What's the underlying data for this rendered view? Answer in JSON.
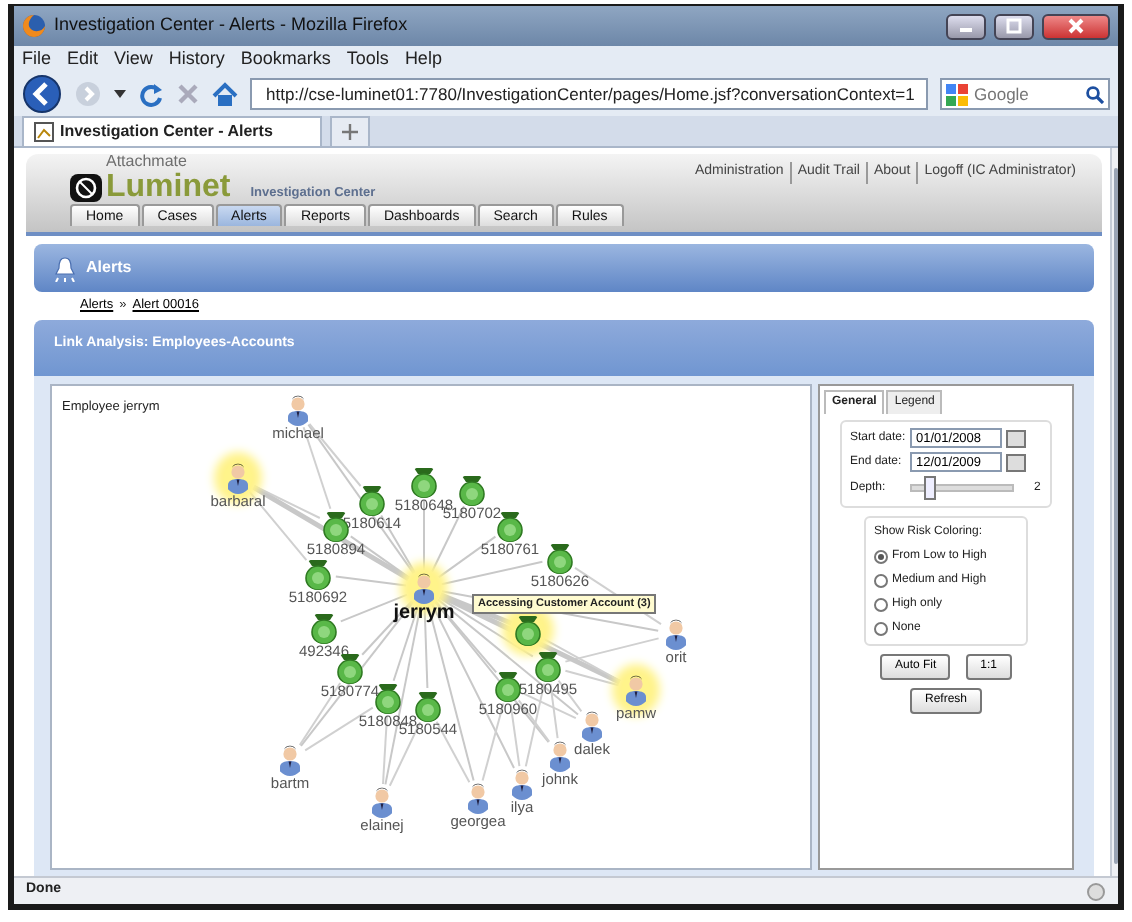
{
  "window": {
    "title": "Investigation Center - Alerts - Mozilla Firefox"
  },
  "menu": [
    "File",
    "Edit",
    "View",
    "History",
    "Bookmarks",
    "Tools",
    "Help"
  ],
  "toolbar": {
    "url": "http://cse-luminet01:7780/InvestigationCenter/pages/Home.jsf?conversationContext=1",
    "search_placeholder": "Google"
  },
  "browser_tabs": [
    {
      "label": "Investigation Center - Alerts",
      "selected": true
    }
  ],
  "app": {
    "brand": {
      "company": "Attachmate",
      "product": "Luminet",
      "module": "Investigation Center"
    },
    "top_links": [
      "Administration",
      "Audit Trail",
      "About",
      "Logoff (IC Administrator)"
    ],
    "tabs": [
      {
        "label": "Home",
        "selected": false
      },
      {
        "label": "Cases",
        "selected": false
      },
      {
        "label": "Alerts",
        "selected": true
      },
      {
        "label": "Reports",
        "selected": false
      },
      {
        "label": "Dashboards",
        "selected": false
      },
      {
        "label": "Search",
        "selected": false
      },
      {
        "label": "Rules",
        "selected": false
      }
    ],
    "section_title": "Alerts",
    "breadcrumb": [
      "Alerts",
      "Alert 00016"
    ],
    "breadcrumb_separator": "»",
    "panel_title": "Link Analysis: Employees-Accounts"
  },
  "graph": {
    "caption": "Employee jerrym",
    "tooltip": "Accessing Customer Account (3)",
    "nodes": [
      {
        "kind": "person",
        "label": "michael",
        "highlighted": false,
        "central": false
      },
      {
        "kind": "person",
        "label": "barbaral",
        "highlighted": true,
        "central": false
      },
      {
        "kind": "account",
        "label": "5180648",
        "highlighted": false,
        "central": false
      },
      {
        "kind": "account",
        "label": "5180702",
        "highlighted": false,
        "central": false
      },
      {
        "kind": "account",
        "label": "5180614",
        "highlighted": false,
        "central": false
      },
      {
        "kind": "account",
        "label": "5180894",
        "highlighted": false,
        "central": false
      },
      {
        "kind": "account",
        "label": "5180761",
        "highlighted": false,
        "central": false
      },
      {
        "kind": "account",
        "label": "5180626",
        "highlighted": false,
        "central": false
      },
      {
        "kind": "account",
        "label": "5180692",
        "highlighted": false,
        "central": false
      },
      {
        "kind": "person",
        "label": "jerrym",
        "highlighted": true,
        "central": true
      },
      {
        "kind": "person",
        "label": "orit",
        "highlighted": false,
        "central": false
      },
      {
        "kind": "account",
        "label": "492346",
        "highlighted": false,
        "central": false
      },
      {
        "kind": "account",
        "highlighted": true
      },
      {
        "kind": "account",
        "label": "5180495",
        "highlighted": false,
        "central": false
      },
      {
        "kind": "account",
        "label": "5180774",
        "highlighted": false,
        "central": false
      },
      {
        "kind": "account",
        "label": "5180960",
        "highlighted": false,
        "central": false
      },
      {
        "kind": "person",
        "label": "pamw",
        "highlighted": true,
        "central": false
      },
      {
        "kind": "account",
        "label": "5180848",
        "highlighted": false,
        "central": false
      },
      {
        "kind": "account",
        "label": "5180544",
        "highlighted": false,
        "central": false
      },
      {
        "kind": "person",
        "label": "dalek",
        "highlighted": false,
        "central": false
      },
      {
        "kind": "person",
        "label": "johnk",
        "highlighted": false,
        "central": false
      },
      {
        "kind": "person",
        "label": "bartm",
        "highlighted": false,
        "central": false
      },
      {
        "kind": "person",
        "label": "ilya",
        "highlighted": false,
        "central": false
      },
      {
        "kind": "person",
        "label": "georgea",
        "highlighted": false,
        "central": false
      },
      {
        "kind": "person",
        "label": "elainej",
        "highlighted": false,
        "central": false
      }
    ]
  },
  "controls": {
    "tabs": [
      {
        "label": "General",
        "selected": true
      },
      {
        "label": "Legend",
        "selected": false
      }
    ],
    "start_date": {
      "label": "Start date:",
      "value": "01/01/2008"
    },
    "end_date": {
      "label": "End date:",
      "value": "12/01/2009"
    },
    "depth": {
      "label": "Depth:",
      "level": 0.15,
      "reading": "2"
    },
    "risk": {
      "title": "Show Risk Coloring:",
      "options": [
        {
          "label": "From Low to High",
          "selected": true
        },
        {
          "label": "Medium and High",
          "selected": false
        },
        {
          "label": "High only",
          "selected": false
        },
        {
          "label": "None",
          "selected": false
        }
      ]
    },
    "buttons": [
      "Auto Fit",
      "1:1",
      "Refresh"
    ]
  },
  "status_bar": "Done"
}
